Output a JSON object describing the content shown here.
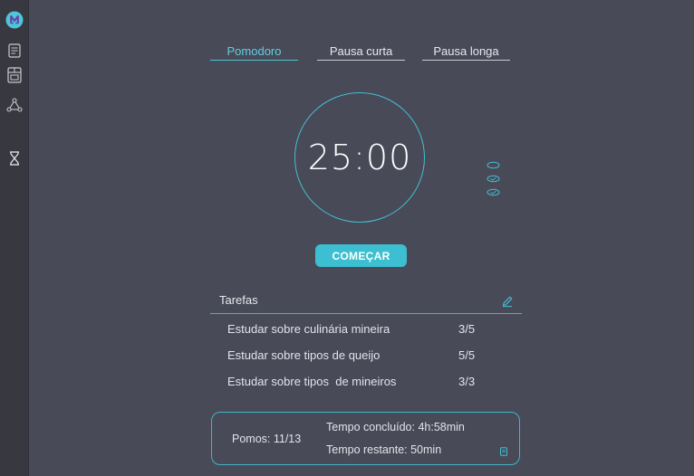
{
  "sidebar": {
    "logo_letter": "M",
    "items": [
      {
        "icon": "document-icon"
      },
      {
        "icon": "board-icon"
      },
      {
        "icon": "graph-icon"
      },
      {
        "icon": "hourglass-icon"
      }
    ]
  },
  "tabs": [
    {
      "label": "Pomodoro",
      "active": true
    },
    {
      "label": "Pausa curta",
      "active": false
    },
    {
      "label": "Pausa longa",
      "active": false
    }
  ],
  "timer": {
    "value": "25:00"
  },
  "start_button": {
    "label": "COMEÇAR"
  },
  "tasks": {
    "title": "Tarefas",
    "items": [
      {
        "name": "Estudar sobre culinária mineira",
        "progress": "3/5"
      },
      {
        "name": "Estudar sobre tipos de queijo",
        "progress": "5/5"
      },
      {
        "name": "Estudar sobre tipos  de mineiros",
        "progress": "3/3"
      }
    ]
  },
  "summary": {
    "pomos": "Pomos: 11/13",
    "completed_time": "Tempo concluído: 4h:58min",
    "remaining_time": "Tempo restante: 50min"
  },
  "colors": {
    "accent": "#3cbfd0",
    "background": "#484a58",
    "sidebar": "#373840"
  }
}
